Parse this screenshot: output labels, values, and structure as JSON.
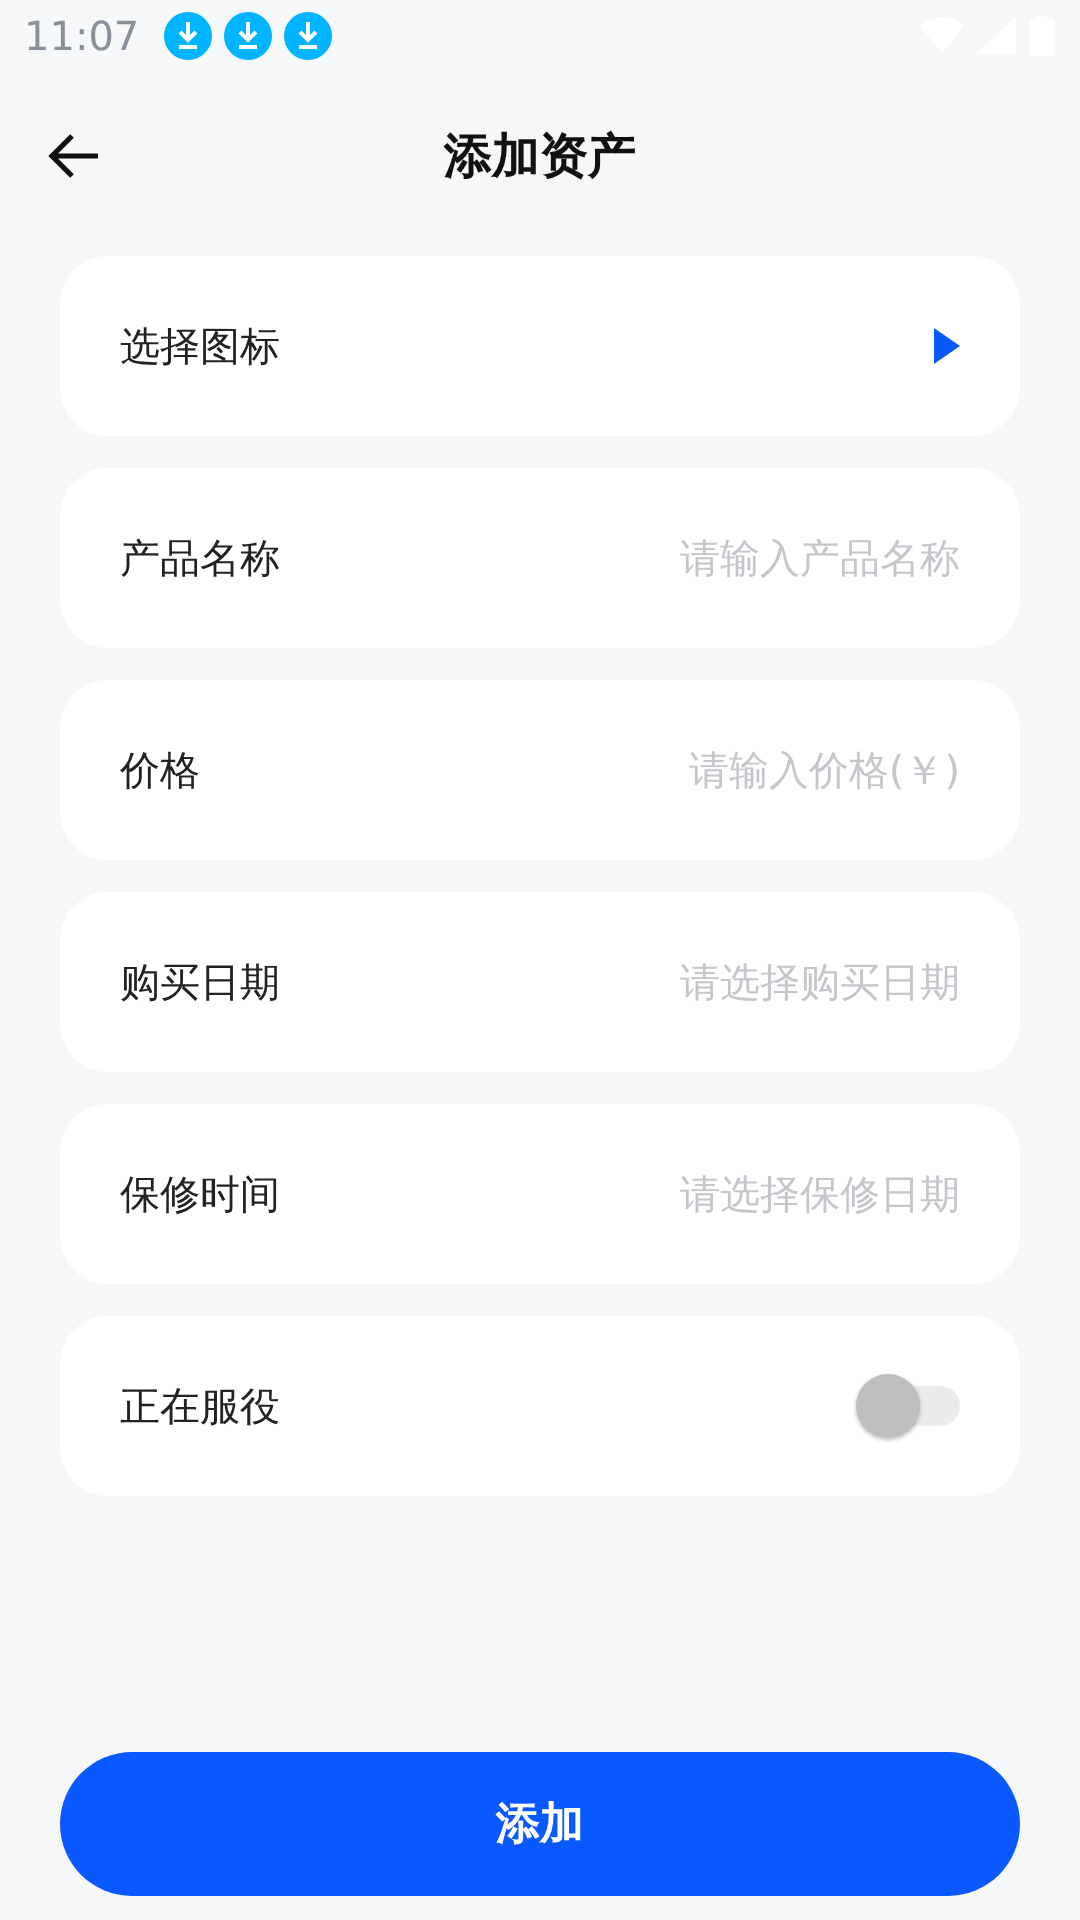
{
  "status_bar": {
    "time": "11:07",
    "notifications": [
      {
        "kind": "download"
      },
      {
        "kind": "download"
      },
      {
        "kind": "download"
      }
    ]
  },
  "header": {
    "title": "添加资产"
  },
  "rows": [
    {
      "kind": "picker",
      "label": "选择图标"
    },
    {
      "kind": "input",
      "label": "产品名称",
      "placeholder": "请输入产品名称"
    },
    {
      "kind": "input",
      "label": "价格",
      "placeholder": "请输入价格(￥)"
    },
    {
      "kind": "input",
      "label": "购买日期",
      "placeholder": "请选择购买日期"
    },
    {
      "kind": "input",
      "label": "保修时间",
      "placeholder": "请选择保修日期"
    },
    {
      "kind": "toggle",
      "label": "正在服役",
      "on": false
    }
  ],
  "submit": {
    "label": "添加"
  }
}
